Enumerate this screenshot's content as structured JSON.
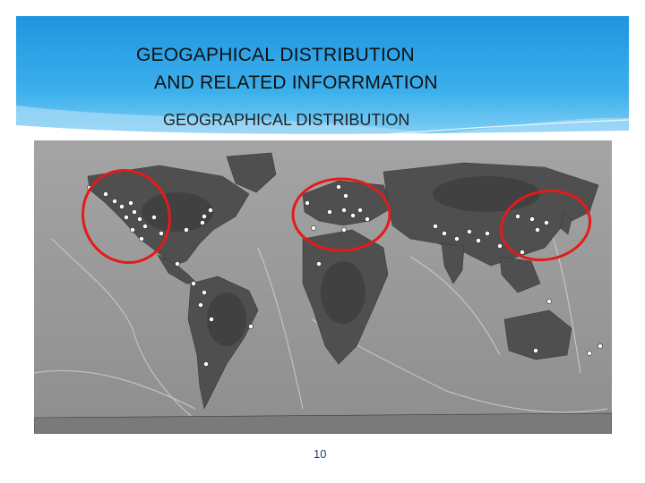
{
  "slide": {
    "title_line1": "GEOGAPHICAL DISTRIBUTION",
    "title_line2": "AND  RELATED INFORRMATION",
    "subtitle": "GEOGRAPHICAL DISTRIBUTION",
    "page_number": "10"
  },
  "colors": {
    "header_blue": "#2a9ee4",
    "header_light": "#79c9f2",
    "highlight_circle": "#e21b1b",
    "map_ocean": "#9a9a9a",
    "map_land": "#4a4a4a",
    "marker": "#ffffff",
    "page_number": "#1f3f77"
  },
  "map": {
    "projection": "world-equirectangular",
    "style": "grayscale-relief",
    "highlight_regions": [
      "western-north-america",
      "mediterranean-europe",
      "east-asia"
    ],
    "marker_type": "white-dot"
  }
}
